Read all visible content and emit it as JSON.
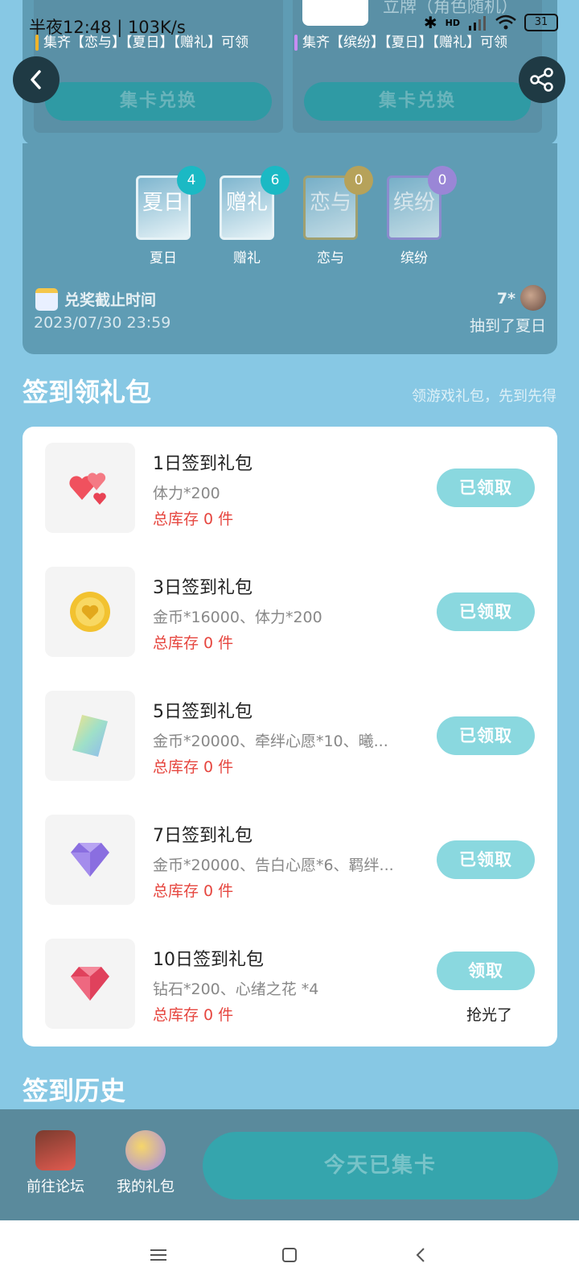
{
  "status_bar": {
    "text": "半夜12:48 | 103K/s",
    "battery": "31",
    "hd": "HD"
  },
  "top_prizes": [
    {
      "desc": "集齐【恋与】【夏日】【赠礼】可领",
      "button": "集卡兑换",
      "bar_color": "#f0b429"
    },
    {
      "name": "立牌（角色随机）",
      "desc": "集齐【缤纷】【夏日】【赠礼】可领",
      "button": "集卡兑换",
      "bar_color": "#c78df2"
    }
  ],
  "cards": [
    {
      "name": "夏日",
      "glyph": "夏日",
      "count": "4",
      "badge_color": "#1bb9c4"
    },
    {
      "name": "赠礼",
      "glyph": "赠礼",
      "count": "6",
      "badge_color": "#1bb9c4"
    },
    {
      "name": "恋与",
      "glyph": "恋与",
      "count": "0",
      "badge_color": "#b6a25a"
    },
    {
      "name": "缤纷",
      "glyph": "缤纷",
      "count": "0",
      "badge_color": "#9a86d6"
    }
  ],
  "deadline": {
    "label": "兑奖截止时间",
    "time": "2023/07/30 23:59",
    "drawer_name": "7*",
    "drawer_text": "抽到了夏日"
  },
  "signin": {
    "title": "签到领礼包",
    "subtitle": "领游戏礼包，先到先得",
    "items": [
      {
        "title": "1日签到礼包",
        "desc": "体力*200",
        "stock": "总库存 0 件",
        "button": "已领取",
        "icon": "hearts-icon",
        "note": ""
      },
      {
        "title": "3日签到礼包",
        "desc": "金币*16000、体力*200",
        "stock": "总库存 0 件",
        "button": "已领取",
        "icon": "gold-coin-icon",
        "note": ""
      },
      {
        "title": "5日签到礼包",
        "desc": "金币*20000、牵绊心愿*10、曦...",
        "stock": "总库存 0 件",
        "button": "已领取",
        "icon": "card-ticket-icon",
        "note": ""
      },
      {
        "title": "7日签到礼包",
        "desc": "金币*20000、告白心愿*6、羁绊...",
        "stock": "总库存 0 件",
        "button": "已领取",
        "icon": "purple-diamond-icon",
        "note": ""
      },
      {
        "title": "10日签到礼包",
        "desc": "钻石*200、心绪之花 *4",
        "stock": "总库存 0 件",
        "button": "领取",
        "icon": "red-diamond-icon",
        "note": "抢光了"
      }
    ]
  },
  "history": {
    "title": "签到历史"
  },
  "bottom_bar": {
    "forum": "前往论坛",
    "gifts": "我的礼包",
    "main_button": "今天已集卡"
  }
}
